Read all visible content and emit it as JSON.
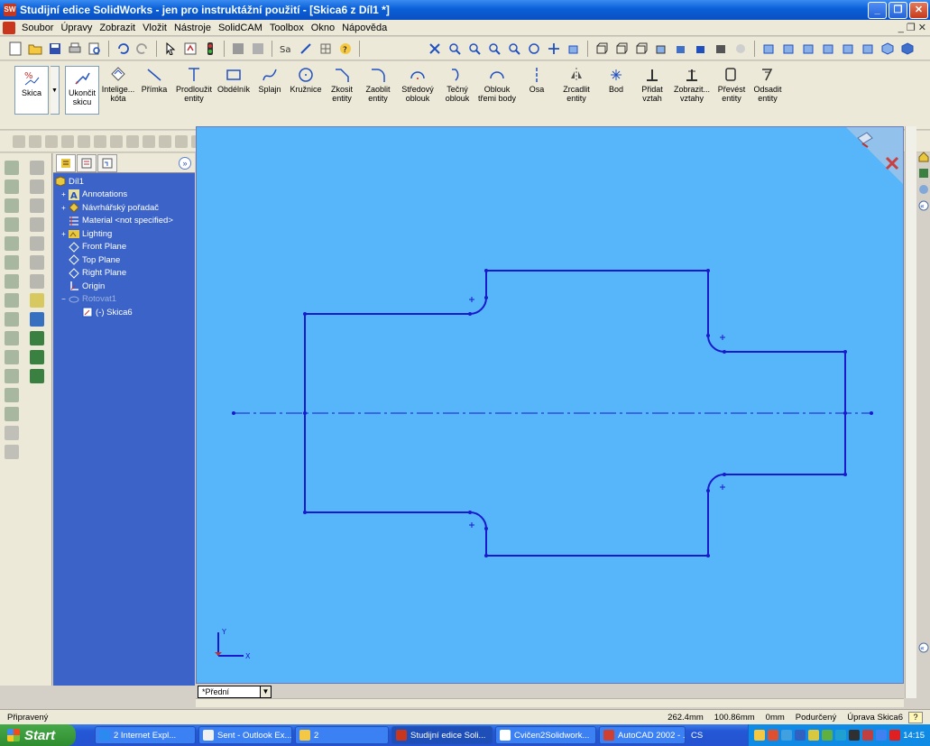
{
  "window": {
    "title": "Studijní edice SolidWorks - jen pro instruktážní použití - [Skica6 z Díl1 *]",
    "app_icon": "SW"
  },
  "menu": [
    "Soubor",
    "Úpravy",
    "Zobrazit",
    "Vložit",
    "Nástroje",
    "SolidCAM",
    "Toolbox",
    "Okno",
    "Nápověda"
  ],
  "command_manager": [
    {
      "label": "Skica",
      "icon": "sketch-icon"
    },
    {
      "label": "Ukončit skicu",
      "icon": "exit-sketch-icon"
    },
    {
      "label": "Inteligentní kóta",
      "short": "Intelige... kóta",
      "icon": "smart-dimension-icon"
    },
    {
      "label": "Přímka",
      "icon": "line-icon"
    },
    {
      "label": "Prodloužit entity",
      "icon": "extend-icon"
    },
    {
      "label": "Obdélník",
      "icon": "rectangle-icon"
    },
    {
      "label": "Splajn",
      "icon": "spline-icon"
    },
    {
      "label": "Kružnice",
      "icon": "circle-icon"
    },
    {
      "label": "Zkosit entity",
      "icon": "chamfer-icon"
    },
    {
      "label": "Zaoblit entity",
      "icon": "fillet-icon"
    },
    {
      "label": "Středový oblouk",
      "icon": "center-arc-icon"
    },
    {
      "label": "Tečný oblouk",
      "icon": "tangent-arc-icon"
    },
    {
      "label": "Oblouk třemi body",
      "icon": "three-point-arc-icon"
    },
    {
      "label": "Osa",
      "icon": "centerline-icon"
    },
    {
      "label": "Zrcadlit entity",
      "icon": "mirror-icon"
    },
    {
      "label": "Bod",
      "icon": "point-icon"
    },
    {
      "label": "Přidat vztah",
      "icon": "add-relation-icon"
    },
    {
      "label": "Zobrazit vztahy",
      "short": "Zobrazit... vztahy",
      "icon": "display-relations-icon"
    },
    {
      "label": "Převést entity",
      "icon": "convert-entities-icon"
    },
    {
      "label": "Odsadit entity",
      "icon": "offset-entities-icon"
    }
  ],
  "feature_tree": {
    "root": "Díl1",
    "items": [
      {
        "label": "Annotations",
        "expandable": true,
        "icon": "annotations-icon"
      },
      {
        "label": "Návrhářský pořadač",
        "expandable": true,
        "icon": "design-binder-icon"
      },
      {
        "label": "Material <not specified>",
        "expandable": false,
        "icon": "material-icon"
      },
      {
        "label": "Lighting",
        "expandable": true,
        "icon": "lighting-icon"
      },
      {
        "label": "Front Plane",
        "expandable": false,
        "icon": "plane-icon"
      },
      {
        "label": "Top Plane",
        "expandable": false,
        "icon": "plane-icon"
      },
      {
        "label": "Right Plane",
        "expandable": false,
        "icon": "plane-icon"
      },
      {
        "label": "Origin",
        "expandable": false,
        "icon": "origin-icon"
      },
      {
        "label": "Rotovat1",
        "expandable": true,
        "icon": "revolve-icon",
        "dim": true
      },
      {
        "label": "(-) Skica6",
        "expandable": false,
        "icon": "sketch-icon",
        "child": true
      }
    ]
  },
  "viewport": {
    "view_name": "*Přední",
    "background": "#57b6fa",
    "sketch_color": "#1a1acc"
  },
  "status": {
    "left": "Připravený",
    "x": "262.4mm",
    "y": "100.86mm",
    "z": "0mm",
    "state": "Podurčený",
    "mode": "Úprava Skica6",
    "help": "?"
  },
  "taskbar": {
    "start": "Start",
    "tasks": [
      {
        "label": "2 Internet Expl...",
        "icon": "ie-icon"
      },
      {
        "label": "Sent - Outlook Ex...",
        "icon": "outlook-icon"
      },
      {
        "label": "2",
        "icon": "folder-icon"
      },
      {
        "label": "Studijní edice Soli...",
        "icon": "solidworks-icon",
        "active": true
      },
      {
        "label": "Cvičen2Solidwork...",
        "icon": "word-icon"
      },
      {
        "label": "AutoCAD 2002 - ...",
        "icon": "autocad-icon"
      }
    ],
    "lang": "CS",
    "clock": "14:15"
  }
}
